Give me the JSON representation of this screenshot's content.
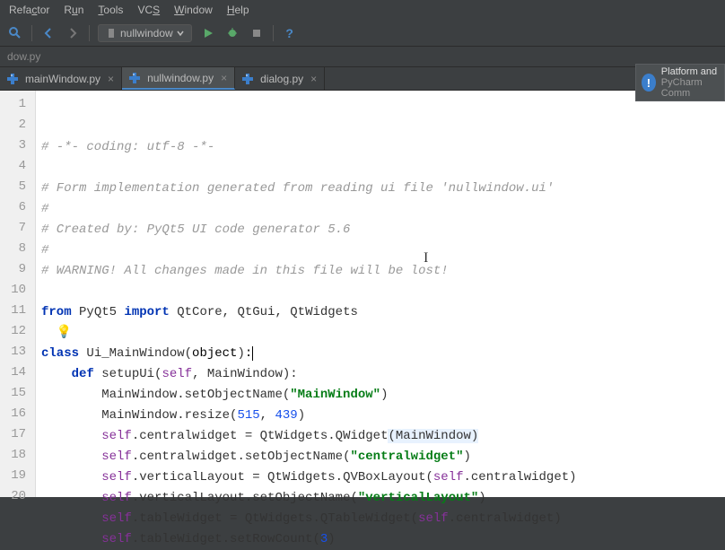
{
  "menu": {
    "refactor": "Refactor",
    "run": "Run",
    "tools": "Tools",
    "vcs": "VCS",
    "window": "Window",
    "help": "Help"
  },
  "runconfig": {
    "label": "nullwindow"
  },
  "breadcrumb": {
    "text": "dow.py"
  },
  "tabs": [
    {
      "label": "mainWindow.py",
      "active": false
    },
    {
      "label": "nullwindow.py",
      "active": true
    },
    {
      "label": "dialog.py",
      "active": false
    }
  ],
  "notification": {
    "title": "Platform and",
    "subtitle": "PyCharm Comm"
  },
  "code": {
    "lines": [
      {
        "n": 1,
        "type": "comment",
        "text": "# -*- coding: utf-8 -*-"
      },
      {
        "n": 2,
        "type": "blank",
        "text": ""
      },
      {
        "n": 3,
        "type": "comment",
        "text": "# Form implementation generated from reading ui file 'nullwindow.ui'"
      },
      {
        "n": 4,
        "type": "comment",
        "text": "#"
      },
      {
        "n": 5,
        "type": "comment",
        "text": "# Created by: PyQt5 UI code generator 5.6"
      },
      {
        "n": 6,
        "type": "comment",
        "text": "#"
      },
      {
        "n": 7,
        "type": "comment",
        "text": "# WARNING! All changes made in this file will be lost!"
      },
      {
        "n": 8,
        "type": "blank",
        "text": ""
      },
      {
        "n": 9,
        "type": "import",
        "kw1": "from",
        "mod": "PyQt5",
        "kw2": "import",
        "names": "QtCore, QtGui, QtWidgets"
      },
      {
        "n": 10,
        "type": "bulb"
      },
      {
        "n": 11,
        "type": "classdef",
        "kw": "class",
        "name": "Ui_MainWindow",
        "base": "object"
      },
      {
        "n": 12,
        "type": "funcdef",
        "kw": "def",
        "name": "setupUi",
        "params_pre": "self",
        "params_post": "MainWindow"
      },
      {
        "n": 13,
        "type": "call",
        "indent": "        ",
        "pre": "MainWindow.setObjectName(",
        "arg_str": "\"MainWindow\"",
        "post": ")"
      },
      {
        "n": 14,
        "type": "resize",
        "indent": "        ",
        "pre": "MainWindow.resize(",
        "a": "515",
        "b": "439",
        "post": ")"
      },
      {
        "n": 15,
        "type": "assign",
        "indent": "        ",
        "selfdot": "self",
        "attr": ".centralwidget = QtWidgets.QWidget",
        "args": "(MainWindow)"
      },
      {
        "n": 16,
        "type": "callself",
        "indent": "        ",
        "selfdot": "self",
        "rest": ".centralwidget.setObjectName(",
        "arg_str": "\"centralwidget\"",
        "post": ")"
      },
      {
        "n": 17,
        "type": "assign2",
        "indent": "        ",
        "selfdot": "self",
        "mid": ".verticalLayout = QtWidgets.QVBoxLayout(",
        "self2": "self",
        "post": ".centralwidget)"
      },
      {
        "n": 18,
        "type": "callself",
        "indent": "        ",
        "selfdot": "self",
        "rest": ".verticalLayout.setObjectName(",
        "arg_str": "\"verticalLayout\"",
        "post": ")"
      },
      {
        "n": 19,
        "type": "assign2",
        "indent": "        ",
        "selfdot": "self",
        "mid": ".tableWidget = QtWidgets.QTableWidget(",
        "self2": "self",
        "post": ".centralwidget)"
      },
      {
        "n": 20,
        "type": "trail",
        "indent": "        ",
        "selfdot": "self",
        "rest": ".tableWidget.setRowCount(",
        "num": "3",
        "post": ")"
      }
    ]
  }
}
